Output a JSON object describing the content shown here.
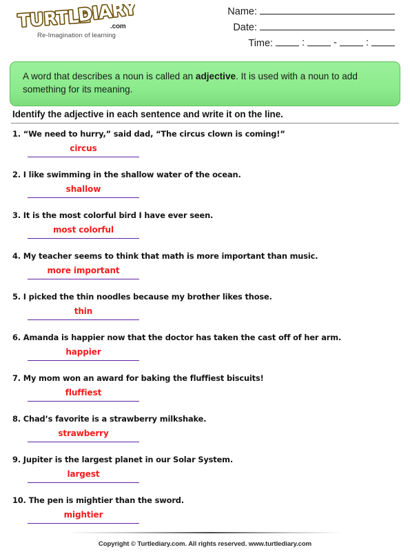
{
  "branding": {
    "logo_text": "TURTLE DIARY",
    "logo_word_1": "TURTLE",
    "logo_word_2": "DIARY",
    "logo_suffix": ".com",
    "tagline": "Re-Imagination of learning",
    "logo_color": "#F9C22E",
    "logo_outline": "#6b5010"
  },
  "header": {
    "name_label": "Name:",
    "date_label": "Date:",
    "time_label": "Time:",
    "time_sep_colon": ":",
    "time_sep_dash": "-"
  },
  "definition": {
    "part_1": "A word that describes a noun is called an ",
    "emphasis": "adjective",
    "part_2": ". It is used with a noun to add something for its meaning.",
    "background_color": "#8CEB8C",
    "border_color": "#5CBF5C"
  },
  "instruction": {
    "text": "Identify the adjective in each sentence and write it on the line."
  },
  "answers": {
    "text_color": "#F61A1A",
    "line_color": "#5C21A5"
  },
  "questions": [
    {
      "number": "1.",
      "sentence": "“We need to hurry,” said dad, “The circus clown is coming!”",
      "answer": "circus"
    },
    {
      "number": "2.",
      "sentence": "I like swimming in the shallow water of the ocean.",
      "answer": "shallow"
    },
    {
      "number": "3.",
      "sentence": "It is the most colorful bird I have ever seen.",
      "answer": "most colorful"
    },
    {
      "number": "4.",
      "sentence": "My teacher seems to think that math is more important than music.",
      "answer": "more important"
    },
    {
      "number": "5.",
      "sentence": "I picked the thin noodles because my brother likes those.",
      "answer": "thin"
    },
    {
      "number": "6.",
      "sentence": "Amanda is happier now that the doctor has taken the cast off of her arm.",
      "answer": "happier"
    },
    {
      "number": "7.",
      "sentence": "My mom won an award for baking the fluffiest biscuits!",
      "answer": "fluffiest"
    },
    {
      "number": "8.",
      "sentence": "Chad’s favorite is a strawberry milkshake.",
      "answer": "strawberry"
    },
    {
      "number": "9.",
      "sentence": "Jupiter is the largest planet in our Solar System.",
      "answer": "largest"
    },
    {
      "number": "10.",
      "sentence": "The pen is mightier than the sword.",
      "answer": "mightier"
    }
  ],
  "footer": {
    "text": "Copyright © Turtlediary.com. All rights reserved. www.turtlediary.com"
  }
}
